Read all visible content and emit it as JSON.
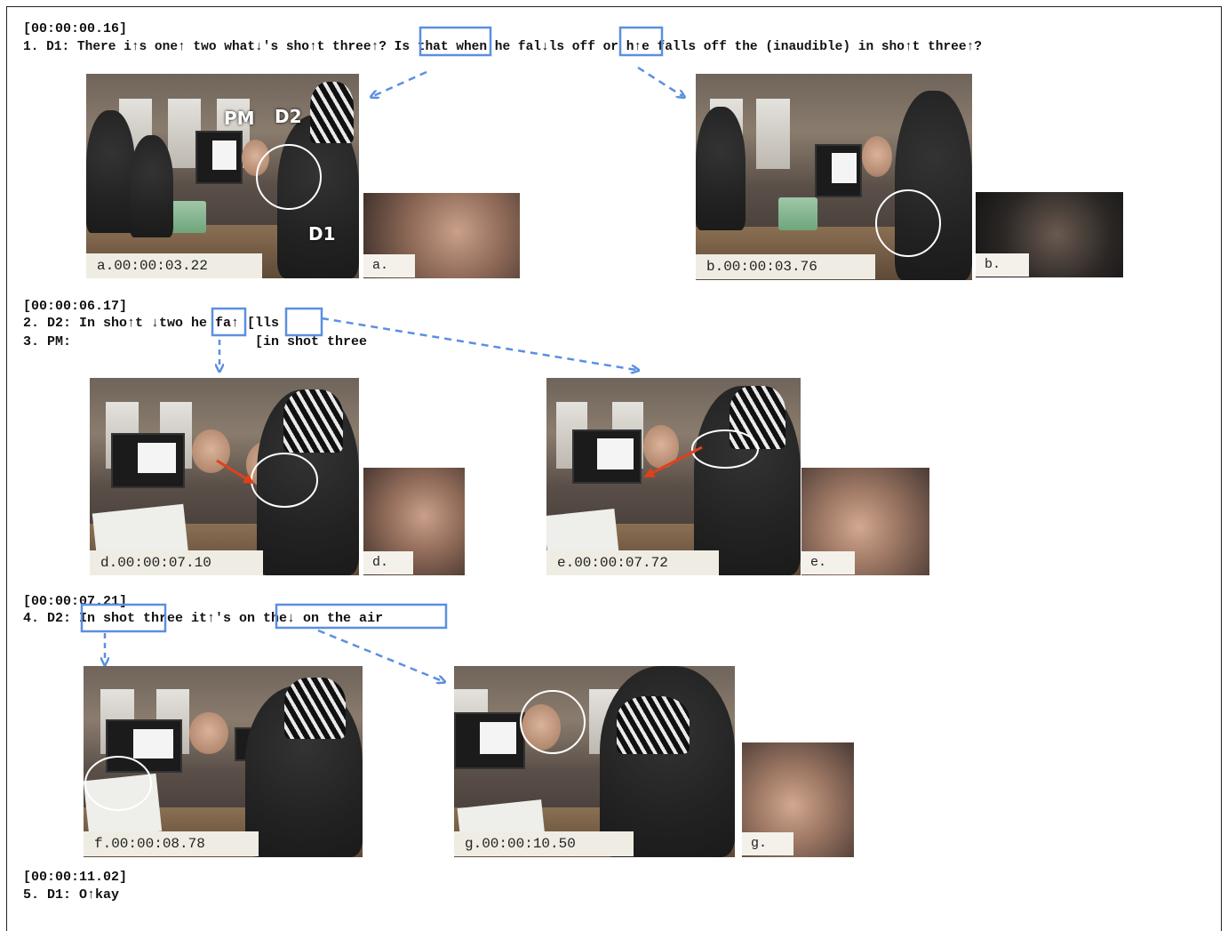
{
  "transcript": {
    "block1": {
      "timestamp": "[00:00:00.16]",
      "line1": "1. D1: There i↑s one↑ two what↓'s sho↑t three↑? Is that when he fal↓ls off or h↑e falls off the (inaudible) in sho↑t three↑?"
    },
    "block2": {
      "timestamp": "[00:00:06.17]",
      "line2": "2. D2: In sho↑t ↓two he fa↑ [lls",
      "line3": "3. PM:                       [in shot three"
    },
    "block3": {
      "timestamp": "[00:00:07.21]",
      "line4": "4. D2: In shot three it↑'s on the↓ on the air"
    },
    "block4": {
      "timestamp": "[00:00:11.02]",
      "line5": "5. D1: O↑kay"
    }
  },
  "stills": {
    "a": {
      "caption": "a.00:00:03.22",
      "zoom_caption": "a.",
      "labels": {
        "pm": "PM",
        "d2": "D2",
        "d1": "D1"
      }
    },
    "b": {
      "caption": "b.00:00:03.76",
      "zoom_caption": "b."
    },
    "d": {
      "caption": "d.00:00:07.10",
      "zoom_caption": "d."
    },
    "e": {
      "caption": "e.00:00:07.72",
      "zoom_caption": "e."
    },
    "f": {
      "caption": "f.00:00:08.78"
    },
    "g": {
      "caption": "g.00:00:10.50",
      "zoom_caption": "g."
    }
  },
  "colors": {
    "highlight_box": "#5b8fe0",
    "arrow_blue": "#5b8fe0",
    "arrow_red": "#e0401c",
    "circle": "#ffffff"
  },
  "icons": {
    "pointer_arrows": "dashed-arrow-icon",
    "gaze_arrows": "red-arrow-icon"
  }
}
